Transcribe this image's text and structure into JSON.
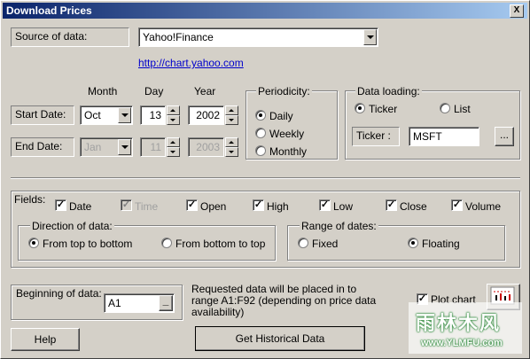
{
  "window": {
    "title": "Download Prices",
    "close_label": "X"
  },
  "source": {
    "label": "Source of data:",
    "value": "Yahoo!Finance",
    "link": "http://chart.yahoo.com"
  },
  "date_headers": {
    "month": "Month",
    "day": "Day",
    "year": "Year"
  },
  "start_date": {
    "label": "Start Date:",
    "month": "Oct",
    "day": "13",
    "year": "2002"
  },
  "end_date": {
    "label": "End Date:",
    "month": "Jan",
    "day": "11",
    "year": "2003"
  },
  "periodicity": {
    "label": "Periodicity:",
    "options": [
      "Daily",
      "Weekly",
      "Monthly"
    ],
    "selected": "Daily"
  },
  "data_loading": {
    "label": "Data loading:",
    "ticker_option": "Ticker",
    "list_option": "List",
    "ticker_label": "Ticker :",
    "ticker_value": "MSFT",
    "browse_label": "..."
  },
  "fields": {
    "label": "Fields:",
    "items": [
      {
        "label": "Date",
        "checked": true,
        "disabled": false
      },
      {
        "label": "Time",
        "checked": true,
        "disabled": true
      },
      {
        "label": "Open",
        "checked": true,
        "disabled": false
      },
      {
        "label": "High",
        "checked": true,
        "disabled": false
      },
      {
        "label": "Low",
        "checked": true,
        "disabled": false
      },
      {
        "label": "Close",
        "checked": true,
        "disabled": false
      },
      {
        "label": "Volume",
        "checked": true,
        "disabled": false
      }
    ]
  },
  "direction": {
    "label": "Direction of data:",
    "top_to_bottom": "From top to bottom",
    "bottom_to_top": "From bottom to top",
    "selected": "From top to bottom"
  },
  "range": {
    "label": "Range of dates:",
    "fixed": "Fixed",
    "floating": "Floating",
    "selected": "Floating"
  },
  "beginning": {
    "label": "Beginning of data:",
    "value": "A1",
    "button": "_"
  },
  "info_text": "Requested data will be placed in to range A1:F92 (depending on price data availability)",
  "plot_chart": {
    "label": "Plot chart",
    "checked": true
  },
  "buttons": {
    "help": "Help",
    "get_historical": "Get Historical Data"
  },
  "watermark": {
    "chinese": "雨林木风",
    "url": "www.YLMFU.com"
  }
}
